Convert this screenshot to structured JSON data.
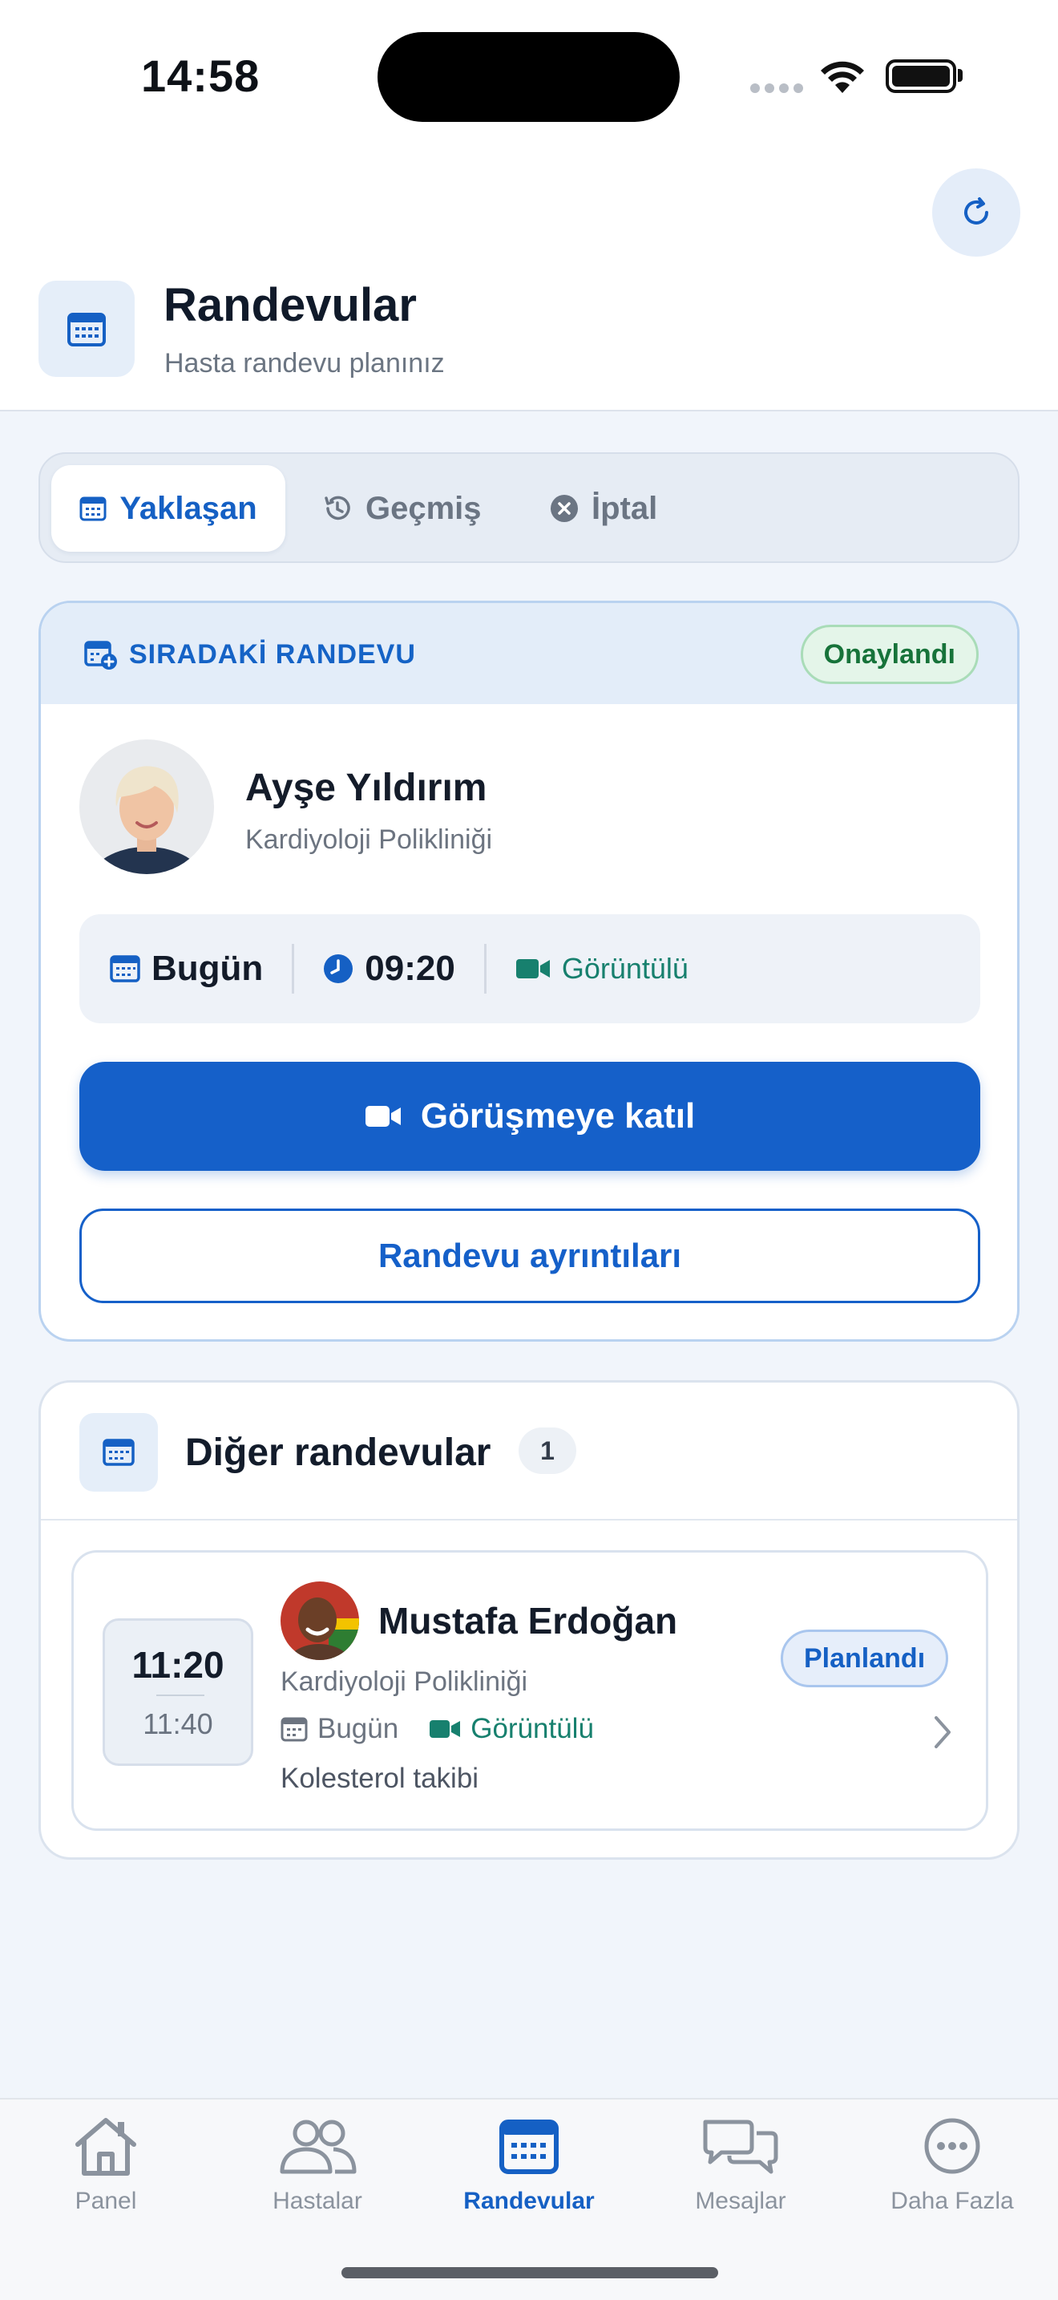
{
  "status_bar": {
    "time": "14:58"
  },
  "header": {
    "title": "Randevular",
    "subtitle": "Hasta randevu planınız",
    "refresh_icon": "refresh-icon",
    "calendar_icon": "calendar-icon"
  },
  "tabs": [
    {
      "label": "Yaklaşan",
      "icon": "calendar-icon",
      "active": true
    },
    {
      "label": "Geçmiş",
      "icon": "history-icon",
      "active": false
    },
    {
      "label": "İptal",
      "icon": "cancel-circle-icon",
      "active": false
    }
  ],
  "next_appointment": {
    "section_label": "SIRADAKİ RANDEVU",
    "status": "Onaylandı",
    "name": "Ayşe Yıldırım",
    "department": "Kardiyoloji Polikliniği",
    "day": "Bugün",
    "time": "09:20",
    "type": "Görüntülü",
    "join_label": "Görüşmeye katıl",
    "details_label": "Randevu ayrıntıları"
  },
  "other_appointments": {
    "title": "Diğer randevular",
    "count": "1",
    "items": [
      {
        "start": "11:20",
        "end": "11:40",
        "name": "Mustafa Erdoğan",
        "department": "Kardiyoloji Polikliniği",
        "day": "Bugün",
        "type": "Görüntülü",
        "note": "Kolesterol takibi",
        "status": "Planlandı"
      }
    ]
  },
  "bottom_nav": [
    {
      "label": "Panel",
      "icon": "home-icon",
      "active": false
    },
    {
      "label": "Hastalar",
      "icon": "users-icon",
      "active": false
    },
    {
      "label": "Randevular",
      "icon": "calendar-icon",
      "active": true
    },
    {
      "label": "Mesajlar",
      "icon": "chat-icon",
      "active": false
    },
    {
      "label": "Daha Fazla",
      "icon": "more-icon",
      "active": false
    }
  ],
  "colors": {
    "accent": "#1560c4",
    "success": "#17733a",
    "video": "#17806e",
    "background": "#f1f5fb"
  }
}
